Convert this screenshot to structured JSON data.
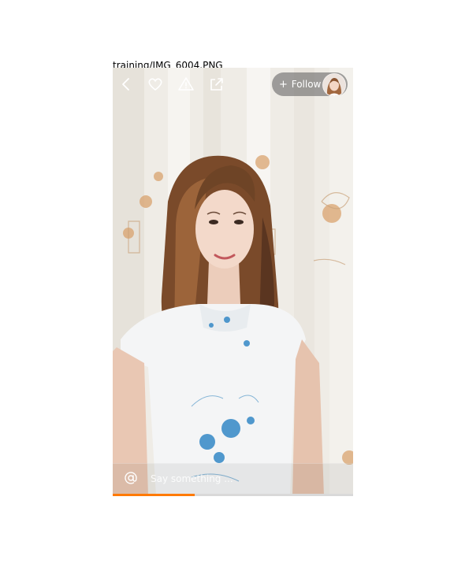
{
  "caption": "training/IMG_6004.PNG",
  "topbar": {
    "back_icon": "chevron-left-icon",
    "like_icon": "heart-icon",
    "report_icon": "warning-icon",
    "share_icon": "share-icon",
    "follow": {
      "plus": "+",
      "label": "Follow"
    }
  },
  "bottombar": {
    "mention_icon": "at-icon",
    "input_placeholder": "Say something ..."
  },
  "progress": {
    "fraction": 0.34,
    "color": "#ff7a00"
  },
  "colors": {
    "follow_pill": "#5a5a5a",
    "dress_blue": "#3f8ec9"
  }
}
